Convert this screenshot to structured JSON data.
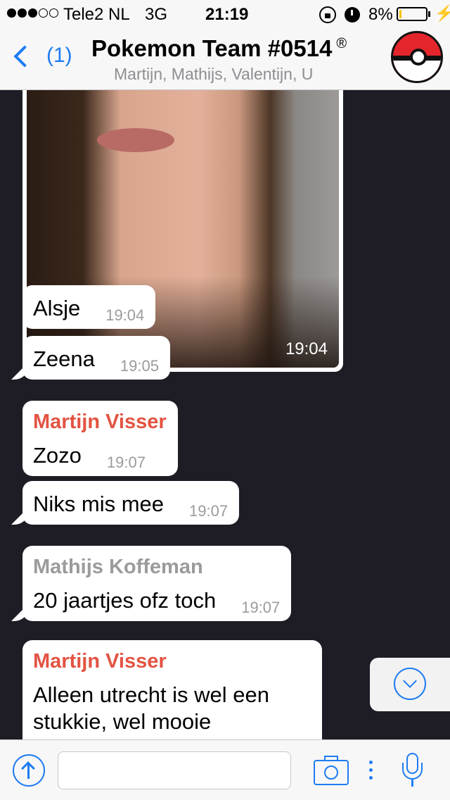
{
  "status_bar": {
    "carrier": "Tele2 NL",
    "network": "3G",
    "time": "21:19",
    "battery_percent_text": "8%",
    "battery_level": 0.08
  },
  "nav": {
    "back_count": "(1)",
    "title": "Pokemon Team #0514",
    "title_mark": "®",
    "subtitle": "Martijn, Mathijs, Valentijn, U"
  },
  "image_message": {
    "time": "19:04"
  },
  "messages": [
    {
      "text": "Alsje",
      "time": "19:04"
    },
    {
      "text": "Zeena",
      "time": "19:05"
    },
    {
      "sender": "Martijn Visser",
      "text": "Zozo",
      "time": "19:07"
    },
    {
      "text": "Niks mis mee",
      "time": "19:07"
    },
    {
      "sender": "Mathijs Koffeman",
      "text": "20 jaartjes ofz toch",
      "time": "19:07"
    },
    {
      "sender": "Martijn Visser",
      "text": "Alleen utrecht is wel een stukkie, wel mooie"
    }
  ],
  "input": {
    "value": "",
    "placeholder": ""
  },
  "colors": {
    "accent": "#1e7cf2",
    "sender_red": "#e35342",
    "sender_gray": "#9b9b9b",
    "chat_background": "#1e1d26"
  },
  "icons": {
    "back": "chevron-left-icon",
    "avatar": "pokeball-avatar",
    "share": "upload-arrow-icon",
    "camera": "camera-icon",
    "more": "more-dots-icon",
    "mic": "microphone-icon",
    "scroll": "chevron-down-circle-icon"
  }
}
